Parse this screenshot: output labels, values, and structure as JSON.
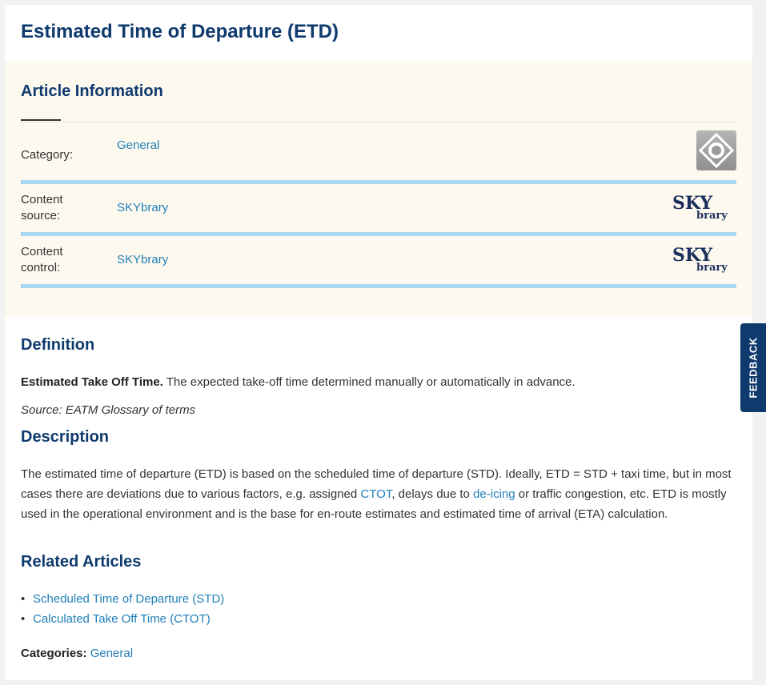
{
  "article": {
    "title": "Estimated Time of Departure (ETD)"
  },
  "info": {
    "heading": "Article Information",
    "rows": [
      {
        "label": "Category:",
        "value": "General",
        "icon": "category-general-icon"
      },
      {
        "label": "Content source:",
        "value": "SKYbrary",
        "logo_top": "SKY",
        "logo_bottom": "brary"
      },
      {
        "label": "Content control:",
        "value": "SKYbrary",
        "logo_top": "SKY",
        "logo_bottom": "brary"
      }
    ]
  },
  "definition": {
    "heading": "Definition",
    "term": "Estimated Take Off Time.",
    "text": " The expected take-off time determined manually or automatically in advance.",
    "source": "Source: EATM Glossary of terms"
  },
  "description": {
    "heading": "Description",
    "part1": "The estimated time of departure (ETD) is based on the scheduled time of departure (STD). Ideally, ETD = STD + taxi time, but in most cases there are deviations due to various factors, e.g. assigned ",
    "link1": "CTOT",
    "part2": ", delays due to ",
    "link2": "de-icing",
    "part3": " or traffic congestion, etc. ETD is mostly used in the operational environment and is the base for en-route estimates and estimated time of arrival (ETA) calculation."
  },
  "related": {
    "heading": "Related Articles",
    "items": [
      "Scheduled Time of Departure (STD)",
      "Calculated Take Off Time (CTOT)"
    ]
  },
  "categories": {
    "label": "Categories:",
    "value": "General"
  },
  "feedback": {
    "label": "FEEDBACK"
  },
  "colors": {
    "heading": "#0f3a6e",
    "link": "#1f7fb8",
    "separator": "#a8d8ef",
    "info_bg": "#fdf9ef"
  }
}
